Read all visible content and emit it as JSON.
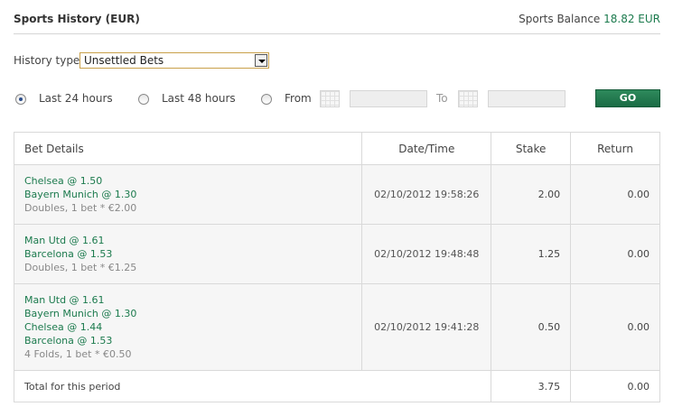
{
  "header": {
    "title": "Sports History (EUR)",
    "balance_label": "Sports Balance",
    "balance_value": "18.82 EUR"
  },
  "filter": {
    "history_type_label": "History type",
    "history_type_value": "Unsettled Bets"
  },
  "range": {
    "opt_24": "Last 24 hours",
    "opt_48": "Last 48 hours",
    "opt_from": "From",
    "to_label": "To",
    "go_label": "GO",
    "selected": "Last 24 hours"
  },
  "table": {
    "headers": {
      "details": "Bet Details",
      "datetime": "Date/Time",
      "stake": "Stake",
      "return": "Return"
    },
    "rows": [
      {
        "selections": [
          "Chelsea @ 1.50",
          "Bayern Munich @ 1.30"
        ],
        "summary": "Doubles, 1 bet * €2.00",
        "datetime": "02/10/2012 19:58:26",
        "stake": "2.00",
        "return": "0.00"
      },
      {
        "selections": [
          "Man Utd @ 1.61",
          "Barcelona @ 1.53"
        ],
        "summary": "Doubles, 1 bet * €1.25",
        "datetime": "02/10/2012 19:48:48",
        "stake": "1.25",
        "return": "0.00"
      },
      {
        "selections": [
          "Man Utd @ 1.61",
          "Bayern Munich @ 1.30",
          "Chelsea @ 1.44",
          "Barcelona @ 1.53"
        ],
        "summary": "4 Folds, 1 bet * €0.50",
        "datetime": "02/10/2012 19:41:28",
        "stake": "0.50",
        "return": "0.00"
      }
    ],
    "total": {
      "label": "Total for this period",
      "stake": "3.75",
      "return": "0.00"
    }
  },
  "colors": {
    "accent_green": "#1b7a4d",
    "go_button": "#1f7a4f",
    "select_border": "#c9a04a"
  }
}
